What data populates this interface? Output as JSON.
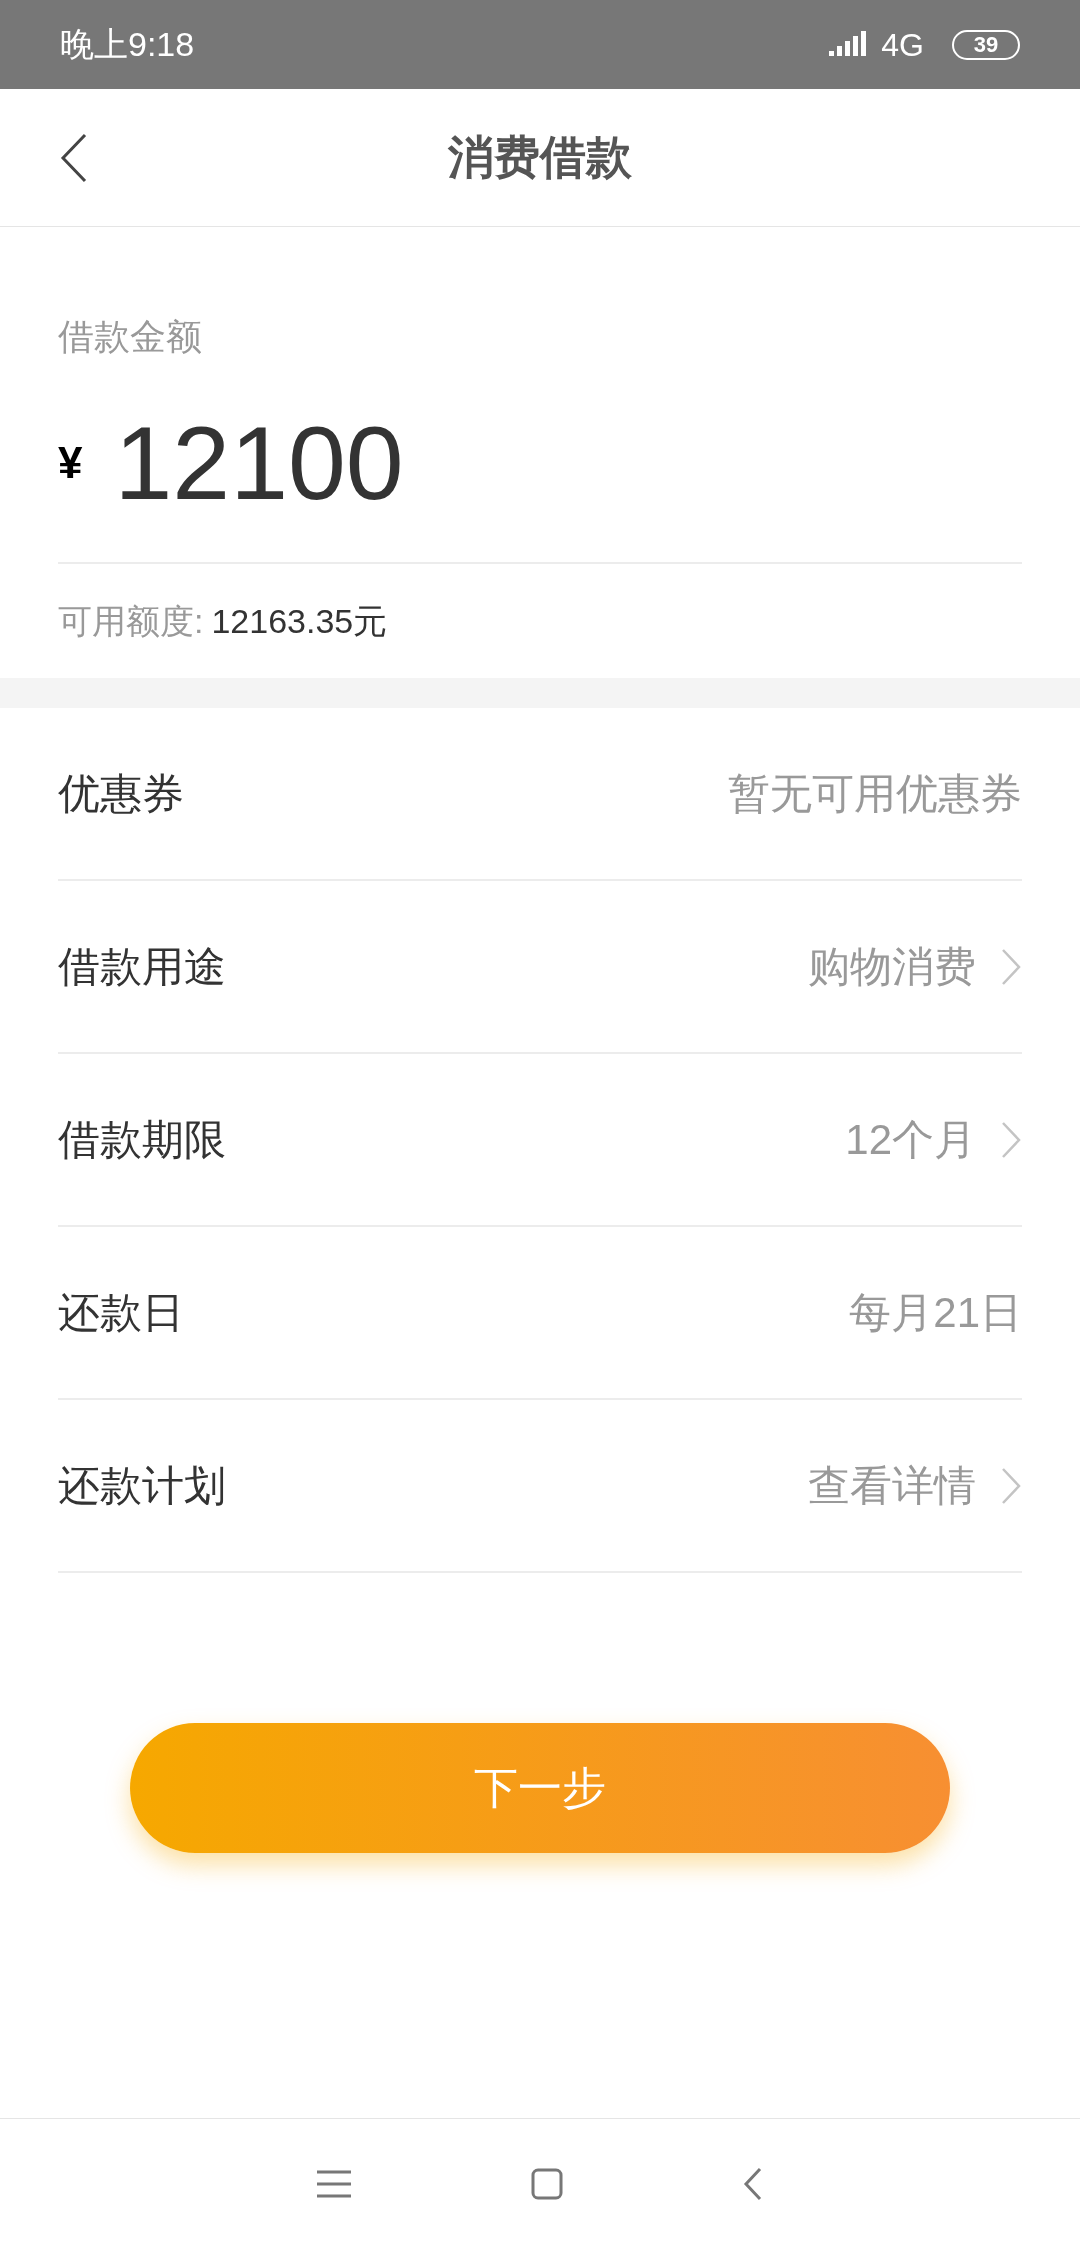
{
  "status_bar": {
    "time": "晚上9:18",
    "network": "4G",
    "battery": "39"
  },
  "header": {
    "title": "消费借款"
  },
  "amount": {
    "label": "借款金额",
    "currency": "¥",
    "value": "12100",
    "available_label": "可用额度:",
    "available_value": "12163.35元"
  },
  "rows": [
    {
      "label": "优惠券",
      "value": "暂无可用优惠券",
      "chevron": false
    },
    {
      "label": "借款用途",
      "value": "购物消费",
      "chevron": true
    },
    {
      "label": "借款期限",
      "value": "12个月",
      "chevron": true
    },
    {
      "label": "还款日",
      "value": "每月21日",
      "chevron": false
    },
    {
      "label": "还款计划",
      "value": "查看详情",
      "chevron": true
    }
  ],
  "next_button": "下一步"
}
